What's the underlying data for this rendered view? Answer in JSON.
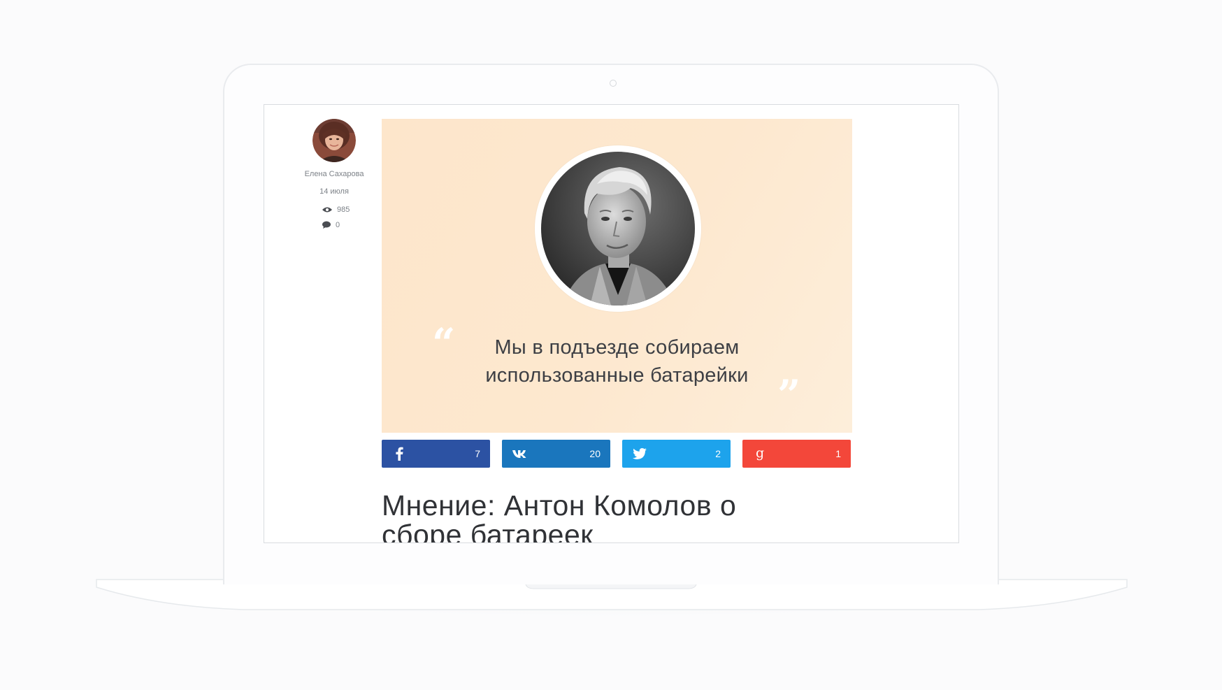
{
  "author": {
    "name": "Елена Сахарова",
    "date": "14 июля",
    "views": "985",
    "comments": "0",
    "avatar_icon": "avatar-photo"
  },
  "hero": {
    "quote_open": "“",
    "quote_close": "”",
    "quote_line1": "Мы в подъезде собираем",
    "quote_line2": "использованные батарейки",
    "background": "#fde7cd",
    "portrait_icon": "person-photo"
  },
  "share": [
    {
      "network": "facebook",
      "icon": "facebook-icon",
      "count": "7",
      "color": "#2c52a3"
    },
    {
      "network": "vk",
      "icon": "vk-icon",
      "count": "20",
      "color": "#1a76bd"
    },
    {
      "network": "twitter",
      "icon": "twitter-icon",
      "count": "2",
      "color": "#1da3ec"
    },
    {
      "network": "google-plus",
      "icon": "google-plus-icon",
      "count": "1",
      "color": "#f3473a"
    }
  ],
  "article": {
    "title_line1": "Мнение: Антон Комолов о",
    "title_line2": "сборе батареек"
  }
}
